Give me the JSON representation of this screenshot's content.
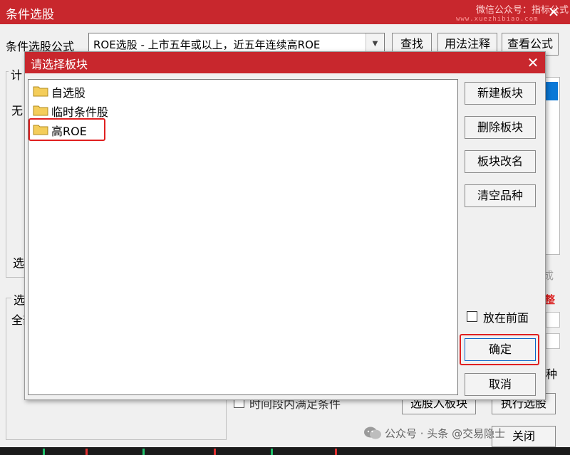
{
  "main_window": {
    "title": "条件选股",
    "watermark": "微信公众号：指标公式",
    "watermark_url": "www.xuezhibiao.com",
    "close_glyph": "✕",
    "formula_label": "条件选股公式",
    "formula_value": "ROE选股 - 上市五年或以上，近五年连续高ROE",
    "buttons": {
      "find": "查找",
      "usage": "用法注释",
      "view_formula": "查看公式",
      "add_to_board": "选股入板块",
      "execute": "执行选股",
      "close": "关闭"
    },
    "group1_caption": "计",
    "none_label": "无",
    "select_label": "选",
    "group2_caption": "选",
    "all_label": "全部",
    "right_grey_text": "成",
    "right_red_text": "整",
    "right_kind_text": "种",
    "interval_label": "时间段内满足条件"
  },
  "board_dialog": {
    "title": "请选择板块",
    "close_glyph": "✕",
    "boards": [
      {
        "label": "自选股",
        "icon": "folder-icon"
      },
      {
        "label": "临时条件股",
        "icon": "folder-icon"
      },
      {
        "label": "高ROE",
        "icon": "folder-icon",
        "highlighted": true
      }
    ],
    "buttons": {
      "new_board": "新建板块",
      "delete_board": "删除板块",
      "rename_board": "板块改名",
      "clear_stocks": "清空品种",
      "ok": "确定",
      "cancel": "取消"
    },
    "place_front_label": "放在前面",
    "place_front_checked": false
  },
  "footer_watermark": "公众号 · 头条 @交易隐士",
  "colors": {
    "titlebar": "#c8272d",
    "highlight_box": "#e02020",
    "folder": "#f4cd5a",
    "selection": "#0a78d7"
  }
}
